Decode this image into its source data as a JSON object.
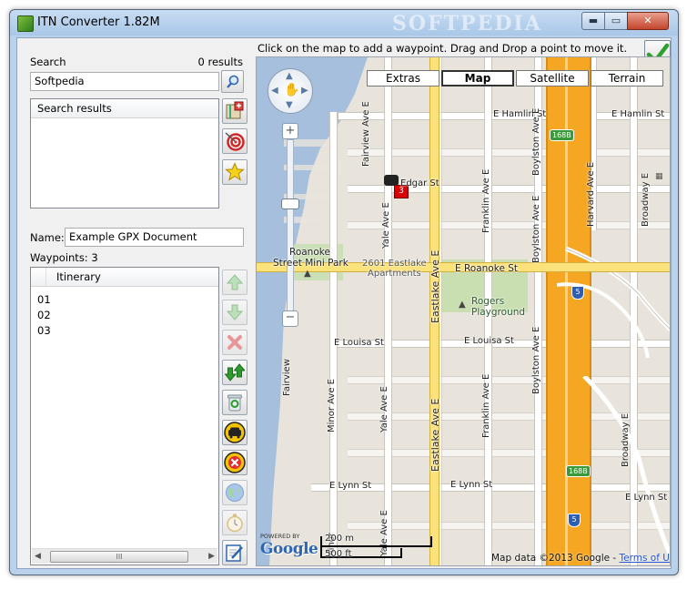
{
  "window": {
    "title": "ITN Converter 1.82M",
    "watermark": "SOFTPEDIA",
    "controls": {
      "minimize": "▬",
      "maximize": "▭",
      "close": "✕"
    }
  },
  "instruction": "Click on the map to add a waypoint. Drag and Drop a point to move it.",
  "search": {
    "label": "Search",
    "results_count": "0 results",
    "value": "Softpedia",
    "results_header": "Search results"
  },
  "doc": {
    "name_label": "Name:",
    "name_value": "Example GPX Document"
  },
  "waypoints": {
    "label": "Waypoints: 3",
    "header": "Itinerary",
    "items": [
      "01",
      "02",
      "03"
    ],
    "scroll_thumb": "III"
  },
  "map": {
    "types": [
      "Extras",
      "Map",
      "Satellite",
      "Terrain"
    ],
    "active_type": "Map",
    "streets": {
      "e_hamlin_1": "E Hamlin St",
      "e_hamlin_2": "E Hamlin St",
      "edgar": "Edgar St",
      "e_roanoke": "E Roanoke St",
      "e_louisa_1": "E Louisa St",
      "e_louisa_2": "E Louisa St",
      "e_lynn_1": "E Lynn St",
      "e_lynn_2": "E Lynn St",
      "e_lynn_3": "E Lynn St",
      "fairview_1": "Fairview Ave E",
      "fairview_2": "Fairview",
      "yale_1": "Yale Ave E",
      "yale_2": "Yale Ave E",
      "yale_3": "Yale Ave E",
      "eastlake_1": "Eastlake Ave E",
      "eastlake_2": "Eastlake Ave E",
      "franklin_1": "Franklin Ave E",
      "franklin_2": "Franklin Ave E",
      "boylston_1": "Boylston Ave E",
      "boylston_2": "Boylston Ave E",
      "boylston_3": "Boylston Ave E",
      "harvard": "Harvard Ave E",
      "broadway_1": "Broadway E",
      "broadway_2": "Broadway E",
      "minor_1": "Minor Ave E",
      "minor_2": "Minor"
    },
    "places": {
      "park_1": "Roanoke",
      "park_2": "Street Mini Park",
      "apt_1": "2601 Eastlake",
      "apt_2": "Apartments",
      "rogers_1": "Rogers",
      "rogers_2": "Playground"
    },
    "shields": {
      "s168b_1": "168B",
      "s168b_2": "168B",
      "i5_1": "5",
      "i5_2": "5"
    },
    "marker_label": "3",
    "scale": {
      "metric": "200 m",
      "imperial": "500 ft"
    },
    "powered_by": "POWERED BY",
    "logo": "Google",
    "copyright": "Map data ©2013 Google - ",
    "terms": "Terms of Use"
  },
  "colors": {
    "highway": "#f5a623",
    "arterial": "#fbe27a",
    "water": "#a5bfdd",
    "park": "#c9dfb2",
    "ok_check": "#2ea02e"
  }
}
